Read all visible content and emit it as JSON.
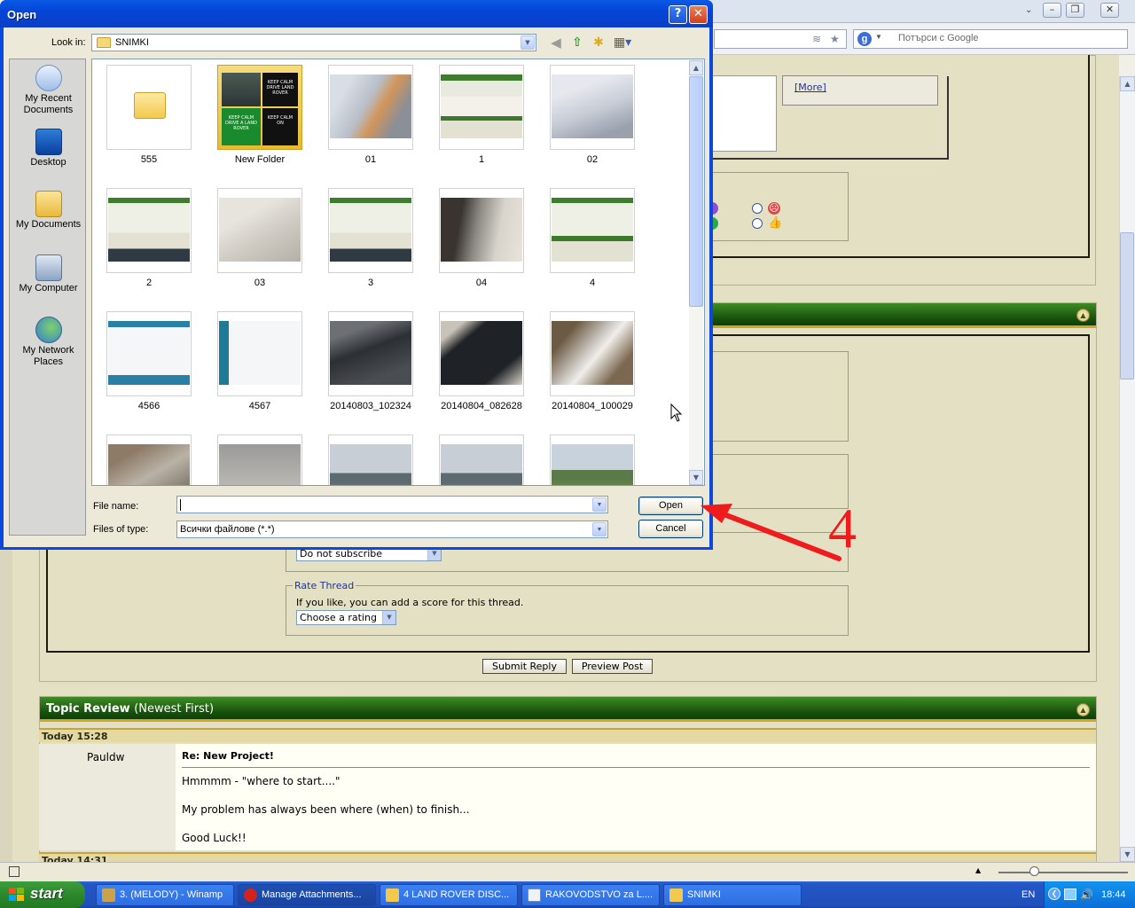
{
  "browser": {
    "search_placeholder": "Потърси с Google",
    "more_link": "[More]"
  },
  "forum": {
    "subscribe_value": "Do not subscribe",
    "rate_legend": "Rate Thread",
    "rate_text": "If you like, you can add a score for this thread.",
    "rating_value": "Choose a rating",
    "submit_label": "Submit Reply",
    "preview_label": "Preview Post",
    "topic_review_title": "Topic Review",
    "topic_review_sub": "(Newest First)",
    "post": {
      "date": "Today 15:28",
      "author": "Pauldw",
      "subject": "Re: New Project!",
      "line1": "Hmmmm - \"where to start....\"",
      "line2": "My problem has always been where (when) to finish...",
      "line3": "Good Luck!!"
    },
    "next_date": "Today 14:31"
  },
  "dialog": {
    "title": "Open",
    "look_in_label": "Look in:",
    "look_in_value": "SNIMKI",
    "places": [
      {
        "label": "My Recent Documents"
      },
      {
        "label": "Desktop"
      },
      {
        "label": "My Documents"
      },
      {
        "label": "My Computer"
      },
      {
        "label": "My Network Places"
      }
    ],
    "files": [
      {
        "name": "555"
      },
      {
        "name": "New Folder"
      },
      {
        "name": "01"
      },
      {
        "name": "1"
      },
      {
        "name": "02"
      },
      {
        "name": "2"
      },
      {
        "name": "03"
      },
      {
        "name": "3"
      },
      {
        "name": "04"
      },
      {
        "name": "4"
      },
      {
        "name": "4566"
      },
      {
        "name": "4567"
      },
      {
        "name": "20140803_102324"
      },
      {
        "name": "20140804_082628"
      },
      {
        "name": "20140804_100029"
      }
    ],
    "new_folder_texts": [
      "KEEP CALM",
      "DRIVE LAND ROVER",
      "KEEP CALM",
      "DRIVE A LAND ROVER",
      "KEEP CALM",
      "ON"
    ],
    "file_name_label": "File name:",
    "file_name_value": "",
    "files_of_type_label": "Files of type:",
    "files_of_type_value": "Всички файлове (*.*)",
    "open_label": "Open",
    "cancel_label": "Cancel"
  },
  "annotation": {
    "number": "4",
    "color": "#ee1c1c"
  },
  "taskbar": {
    "start_label": "start",
    "tasks": [
      {
        "label": "3. (MELODY) - Winamp"
      },
      {
        "label": "Manage Attachments..."
      },
      {
        "label": "4 LAND ROVER DISC..."
      },
      {
        "label": "RAKOVODSTVO za L...."
      },
      {
        "label": "SNIMKI"
      }
    ],
    "language": "EN",
    "clock": "18:44"
  }
}
